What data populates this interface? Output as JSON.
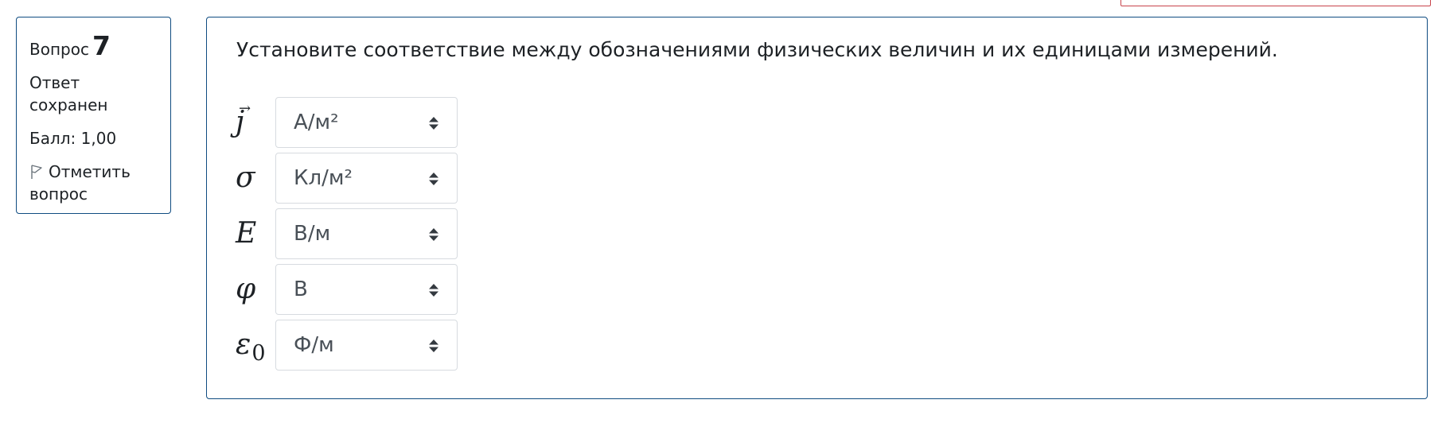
{
  "info": {
    "question_label": "Вопрос",
    "question_number": "7",
    "state_line1": "Ответ",
    "state_line2": "сохранен",
    "grade": "Балл: 1,00",
    "flag_line1": "Отметить",
    "flag_line2": "вопрос"
  },
  "question": {
    "text": "Установите соответствие между обозначениями физических величин и их единицами измерений.",
    "rows": [
      {
        "symbol": "j",
        "symbol_arrow": "→",
        "symbol_sub": "",
        "selected": "А/м²"
      },
      {
        "symbol": "σ",
        "symbol_arrow": "",
        "symbol_sub": "",
        "selected": "Кл/м²"
      },
      {
        "symbol": "E",
        "symbol_arrow": "",
        "symbol_sub": "",
        "selected": "В/м"
      },
      {
        "symbol": "φ",
        "symbol_arrow": "",
        "symbol_sub": "",
        "selected": "В"
      },
      {
        "symbol": "ε",
        "symbol_arrow": "",
        "symbol_sub": "0",
        "selected": "Ф/м"
      }
    ]
  },
  "icons": {
    "flag": "flag-icon",
    "select_caret": "sort-caret-icon"
  },
  "colors": {
    "border": "#0f4c81",
    "text": "#1d2125",
    "select_border": "#d7dbe0",
    "select_text": "#495057",
    "alert_border": "#c8434b"
  }
}
